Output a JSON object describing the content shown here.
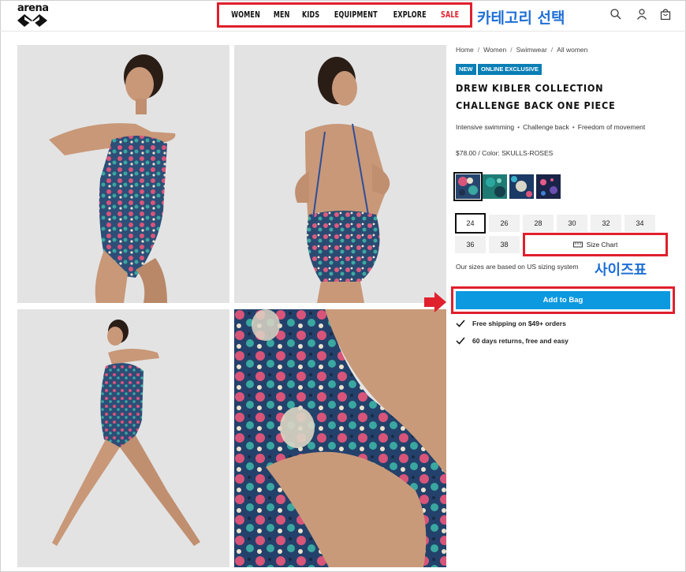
{
  "header": {
    "logo_text": "arena",
    "nav": [
      {
        "label": "WOMEN"
      },
      {
        "label": "MEN"
      },
      {
        "label": "KIDS"
      },
      {
        "label": "EQUIPMENT"
      },
      {
        "label": "EXPLORE"
      },
      {
        "label": "SALE"
      }
    ],
    "annotation_category": "카테고리 선택",
    "icons": [
      "search-icon",
      "user-icon",
      "bag-icon"
    ]
  },
  "breadcrumb": [
    "Home",
    "Women",
    "Swimwear",
    "All women"
  ],
  "badges": [
    "NEW",
    "ONLINE EXCLUSIVE"
  ],
  "product": {
    "title": "DREW KIBLER COLLECTION CHALLENGE BACK ONE PIECE",
    "features": [
      "Intensive swimming",
      "Challenge back",
      "Freedom of movement"
    ],
    "price_line": "$78.00 / Color: SKULLS-ROSES"
  },
  "colors": {
    "accent_blue": "#0d99e0",
    "badge_blue": "#0a7fb5",
    "annotation_red": "#e0202c",
    "annotation_text_blue": "#1e6fd6"
  },
  "swatches": [
    "skulls-roses",
    "teal-floral",
    "blue-skull",
    "navy-pink"
  ],
  "sizes": [
    "24",
    "26",
    "28",
    "30",
    "32",
    "34",
    "36",
    "38"
  ],
  "selected_size": "24",
  "size_chart_label": "Size Chart",
  "annotation_size": "사이즈표",
  "sizes_note": "Our sizes are based on US sizing system",
  "add_to_bag": "Add to Bag",
  "perks": [
    "Free shipping on $49+ orders",
    "60 days returns, free and easy"
  ]
}
